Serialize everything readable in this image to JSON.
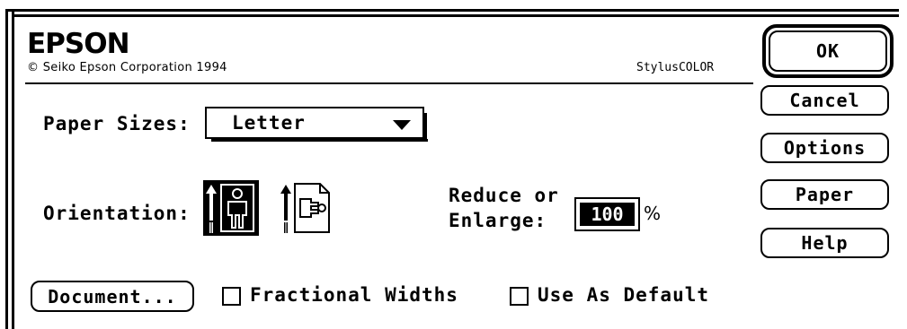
{
  "header": {
    "brand": "EPSON",
    "copyright": "© Seiko Epson Corporation 1994",
    "model": "StylusCOLOR"
  },
  "paper_sizes": {
    "label": "Paper Sizes:",
    "selected": "Letter"
  },
  "orientation": {
    "label": "Orientation:",
    "options": [
      "portrait",
      "landscape"
    ],
    "selected": "portrait"
  },
  "scale": {
    "label_line1": "Reduce or",
    "label_line2": "Enlarge:",
    "value": "100",
    "unit": "%"
  },
  "buttons": {
    "ok": "OK",
    "cancel": "Cancel",
    "options": "Options",
    "paper": "Paper",
    "help": "Help",
    "document": "Document..."
  },
  "checkboxes": [
    {
      "label": "Fractional Widths",
      "checked": false
    },
    {
      "label": "Use As Default",
      "checked": false
    }
  ]
}
